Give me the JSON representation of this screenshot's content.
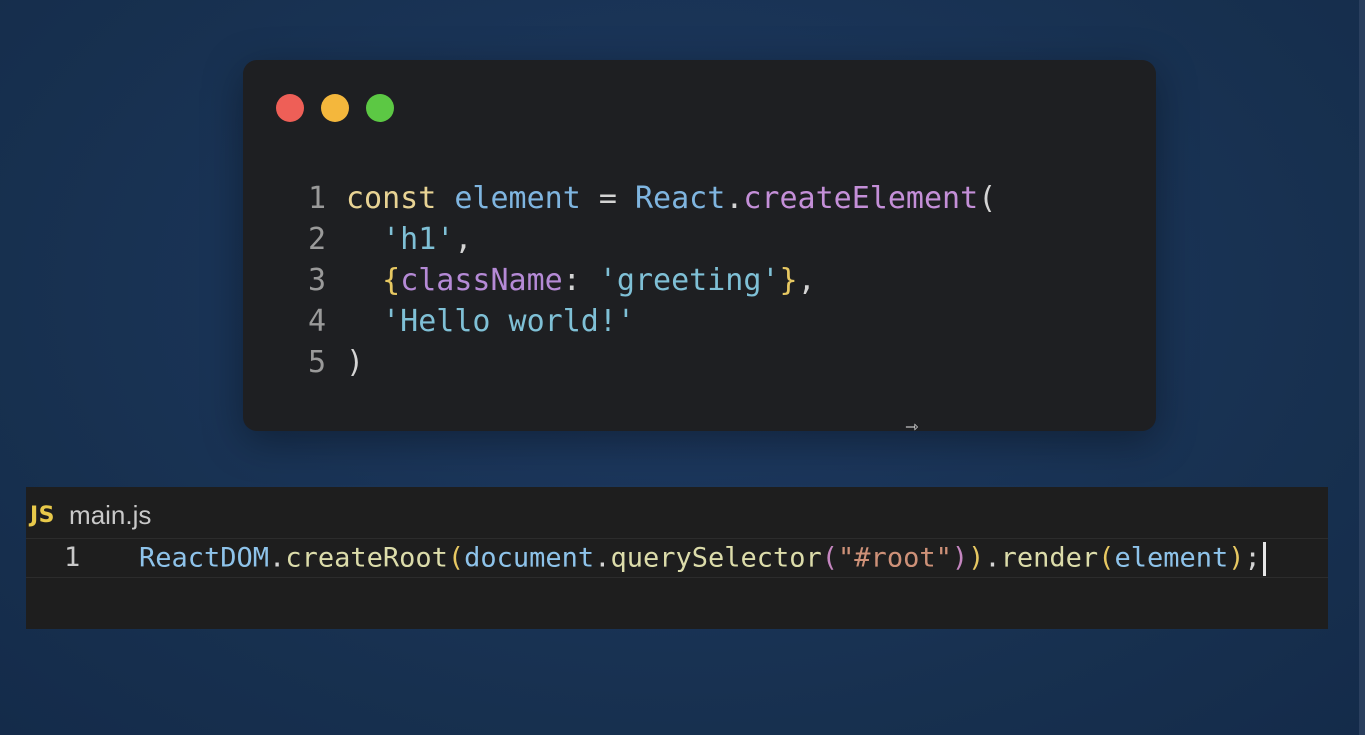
{
  "window_dots": {
    "close_color": "#ee5f57",
    "minimize_color": "#f4b73c",
    "maximize_color": "#5cc844"
  },
  "code_window": {
    "lines": [
      {
        "number": "1",
        "tokens": [
          {
            "text": "const",
            "kind": "kw"
          },
          {
            "text": " ",
            "kind": "punc"
          },
          {
            "text": "element",
            "kind": "var"
          },
          {
            "text": " = ",
            "kind": "punc"
          },
          {
            "text": "React",
            "kind": "obj"
          },
          {
            "text": ".",
            "kind": "punc"
          },
          {
            "text": "createElement",
            "kind": "fn"
          },
          {
            "text": "(",
            "kind": "punc"
          }
        ]
      },
      {
        "number": "2",
        "tokens": [
          {
            "text": "  ",
            "kind": "punc"
          },
          {
            "text": "'h1'",
            "kind": "str"
          },
          {
            "text": ",",
            "kind": "punc"
          }
        ]
      },
      {
        "number": "3",
        "tokens": [
          {
            "text": "  ",
            "kind": "punc"
          },
          {
            "text": "{",
            "kind": "brace"
          },
          {
            "text": "className",
            "kind": "prop"
          },
          {
            "text": ": ",
            "kind": "punc"
          },
          {
            "text": "'greeting'",
            "kind": "str"
          },
          {
            "text": "}",
            "kind": "brace"
          },
          {
            "text": ",",
            "kind": "punc"
          }
        ]
      },
      {
        "number": "4",
        "tokens": [
          {
            "text": "  ",
            "kind": "punc"
          },
          {
            "text": "'Hello world!'",
            "kind": "str"
          }
        ]
      },
      {
        "number": "5",
        "tokens": [
          {
            "text": ")",
            "kind": "punc"
          }
        ]
      }
    ]
  },
  "pointer": {
    "icon": "arrow-cursor-icon",
    "glyph": "⇾"
  },
  "editor": {
    "tab": {
      "badge": "JS",
      "filename": "main.js"
    },
    "line_number": "1",
    "tokens": [
      {
        "text": "ReactDOM",
        "kind": "obj"
      },
      {
        "text": ".",
        "kind": "punc"
      },
      {
        "text": "createRoot",
        "kind": "fn"
      },
      {
        "text": "(",
        "kind": "paren1"
      },
      {
        "text": "document",
        "kind": "obj"
      },
      {
        "text": ".",
        "kind": "punc"
      },
      {
        "text": "querySelector",
        "kind": "fn"
      },
      {
        "text": "(",
        "kind": "paren2"
      },
      {
        "text": "\"#root\"",
        "kind": "str"
      },
      {
        "text": ")",
        "kind": "paren2"
      },
      {
        "text": ")",
        "kind": "paren1"
      },
      {
        "text": ".",
        "kind": "punc"
      },
      {
        "text": "render",
        "kind": "fn"
      },
      {
        "text": "(",
        "kind": "paren1"
      },
      {
        "text": "element",
        "kind": "obj"
      },
      {
        "text": ")",
        "kind": "paren1"
      },
      {
        "text": ";",
        "kind": "punc"
      }
    ]
  }
}
